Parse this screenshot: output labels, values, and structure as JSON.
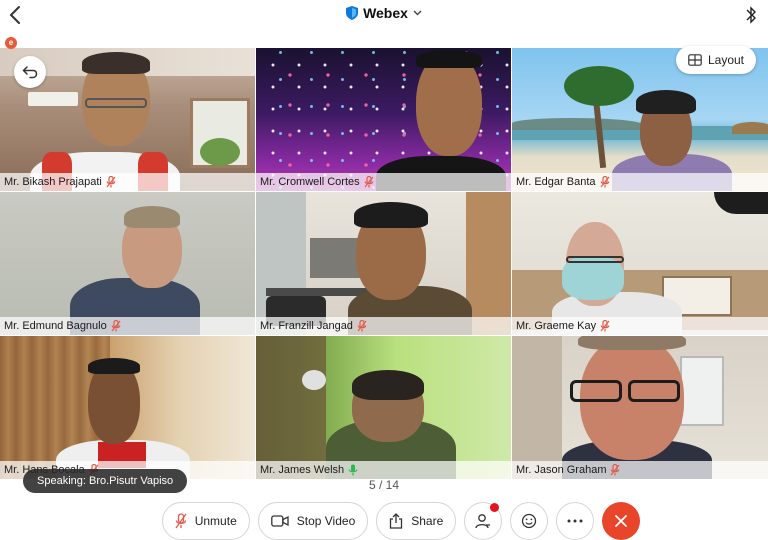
{
  "header": {
    "title": "Webex",
    "icons": {
      "back": "chevron-left-icon",
      "brand": "webex-shield-icon",
      "dropdown": "chevron-down-icon",
      "status": "bluetooth-icon"
    }
  },
  "recording_badge": {
    "label": "e",
    "color": "#e85a3a"
  },
  "layout_button": {
    "label": "Layout",
    "icon": "grid-layout-icon"
  },
  "participants": [
    {
      "name": "Mr. Bikash Prajapati",
      "mic": "muted"
    },
    {
      "name": "Mr. Cromwell Cortes",
      "mic": "muted"
    },
    {
      "name": "Mr. Edgar Banta",
      "mic": "muted"
    },
    {
      "name": "Mr. Edmund Bagnulo",
      "mic": "muted"
    },
    {
      "name": "Mr. Franzill Jangad",
      "mic": "muted"
    },
    {
      "name": "Mr. Graeme Kay",
      "mic": "muted"
    },
    {
      "name": "Mr. Hans Bocala",
      "mic": "muted"
    },
    {
      "name": "Mr. James Welsh",
      "mic": "active"
    },
    {
      "name": "Mr. Jason  Graham",
      "mic": "muted"
    }
  ],
  "speaking": {
    "label": "Speaking: Bro.Pisutr Vapiso"
  },
  "pagination": {
    "text": "5 / 14",
    "current": 5,
    "total": 14
  },
  "toolbar": {
    "unmute_label": "Unmute",
    "stop_video_label": "Stop Video",
    "share_label": "Share",
    "participants_icon": "participants-icon",
    "reactions_icon": "smiley-icon",
    "more_icon": "more-icon",
    "end_icon": "close-icon"
  },
  "colors": {
    "accent": "#0a7bd6",
    "muted_mic": "#e25a4a",
    "active_mic": "#2fb84a",
    "end_call": "#e8452b",
    "notification_dot": "#e4141e"
  }
}
